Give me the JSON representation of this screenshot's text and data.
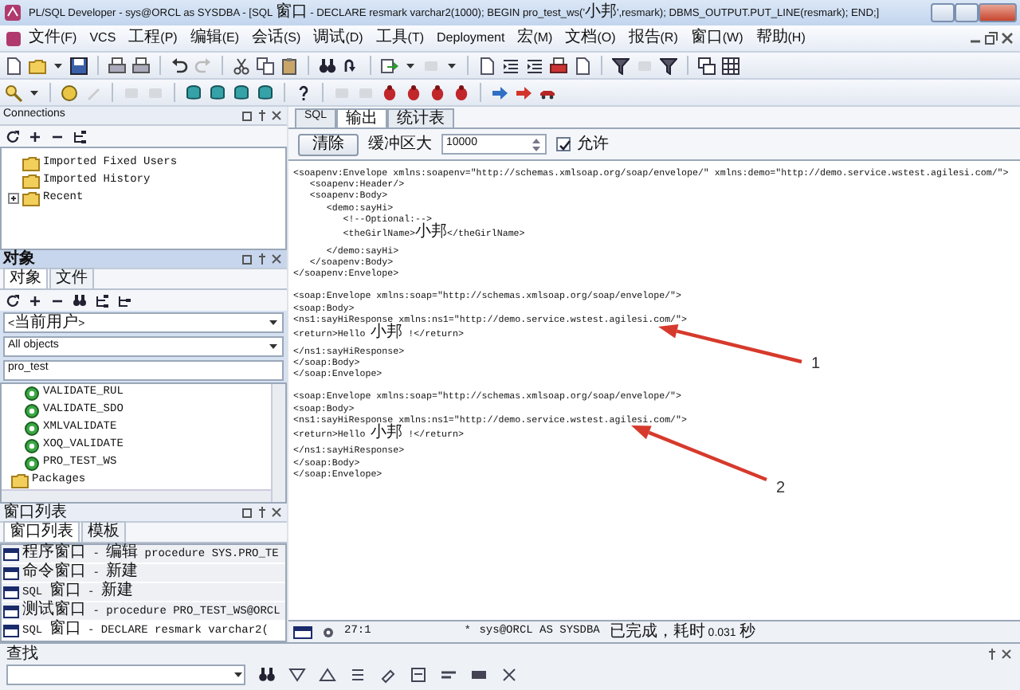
{
  "window": {
    "title": "PL/SQL Developer - sys@ORCL as SYSDBA - [SQL 窗口 - DECLARE resmark varchar2(1000); BEGIN pro_test_ws('小邦',resmark); DBMS_OUTPUT.PUT_LINE(resmark); END;]"
  },
  "menu": [
    "文件(F)",
    "VCS",
    "工程(P)",
    "编辑(E)",
    "会话(S)",
    "调试(D)",
    "工具(T)",
    "Deployment",
    "宏(M)",
    "文档(O)",
    "报告(R)",
    "窗口(W)",
    "帮助(H)"
  ],
  "connections": {
    "title": "Connections",
    "items": [
      {
        "label": "Imported Fixed Users",
        "expandable": false
      },
      {
        "label": "Imported History",
        "expandable": false
      },
      {
        "label": "Recent",
        "expandable": true
      }
    ]
  },
  "objects": {
    "title": "对象",
    "tabs": [
      {
        "label": "对象",
        "selected": true
      },
      {
        "label": "文件",
        "selected": false
      }
    ],
    "owner": "<当前用户>",
    "object_type": "All objects",
    "filter": "pro_test",
    "items": [
      {
        "label": "VALIDATE_RUL",
        "kind": "procedure"
      },
      {
        "label": "VALIDATE_SDO",
        "kind": "procedure"
      },
      {
        "label": "XMLVALIDATE",
        "kind": "procedure"
      },
      {
        "label": "XOQ_VALIDATE",
        "kind": "procedure"
      },
      {
        "label": "PRO_TEST_WS",
        "kind": "procedure"
      },
      {
        "label": "Packages",
        "kind": "folder"
      }
    ]
  },
  "window_list": {
    "title": "窗口列表",
    "tabs": [
      {
        "label": "窗口列表",
        "selected": true
      },
      {
        "label": "模板",
        "selected": false
      }
    ],
    "items": [
      {
        "label": "程序窗口 - 编辑 procedure SYS.PRO_TE",
        "selected": false
      },
      {
        "label": "命令窗口 - 新建",
        "selected": false
      },
      {
        "label": "SQL 窗口 - 新建",
        "selected": false
      },
      {
        "label": "测试窗口 - procedure PRO_TEST_WS@ORCL",
        "selected": false
      },
      {
        "label": "SQL 窗口 - DECLARE resmark varchar2(",
        "selected": true
      }
    ]
  },
  "editor": {
    "tabs": [
      {
        "label": "SQL",
        "selected": false
      },
      {
        "label": "输出",
        "selected": true
      },
      {
        "label": "统计表",
        "selected": false
      }
    ],
    "clear_button": "清除",
    "buffer_label": "缓冲区大",
    "buffer_size": "10000",
    "enable": {
      "label": "允许",
      "checked": true
    },
    "output_blocks": [
      [
        "<soapenv:Envelope xmlns:soapenv=\"http://schemas.xmlsoap.org/soap/envelope/\" xmlns:demo=\"http://demo.service.wstest.agilesi.com/\">",
        "   <soapenv:Header/>",
        "   <soapenv:Body>",
        "      <demo:sayHi>",
        "         <!--Optional:-->",
        "         <theGirlName>小邦</theGirlName>",
        "      </demo:sayHi>",
        "   </soapenv:Body>",
        "</soapenv:Envelope>"
      ],
      [
        "<soap:Envelope xmlns:soap=\"http://schemas.xmlsoap.org/soap/envelope/\">",
        "<soap:Body>",
        "<ns1:sayHiResponse xmlns:ns1=\"http://demo.service.wstest.agilesi.com/\">",
        "<return>Hello 小邦 !</return>",
        "</ns1:sayHiResponse>",
        "</soap:Body>",
        "</soap:Envelope>"
      ],
      [
        "<soap:Envelope xmlns:soap=\"http://schemas.xmlsoap.org/soap/envelope/\">",
        "<soap:Body>",
        "<ns1:sayHiResponse xmlns:ns1=\"http://demo.service.wstest.agilesi.com/\">",
        "<return>Hello 小邦 !</return>",
        "</ns1:sayHiResponse>",
        "</soap:Body>",
        "</soap:Envelope>"
      ]
    ],
    "annotations": [
      {
        "label": "1"
      },
      {
        "label": "2"
      }
    ]
  },
  "status_bar": {
    "position": "27:1",
    "modified": "*",
    "connection": "sys@ORCL AS SYSDBA",
    "message": "已完成，耗时 0.031 秒"
  },
  "find": {
    "title": "查找"
  }
}
